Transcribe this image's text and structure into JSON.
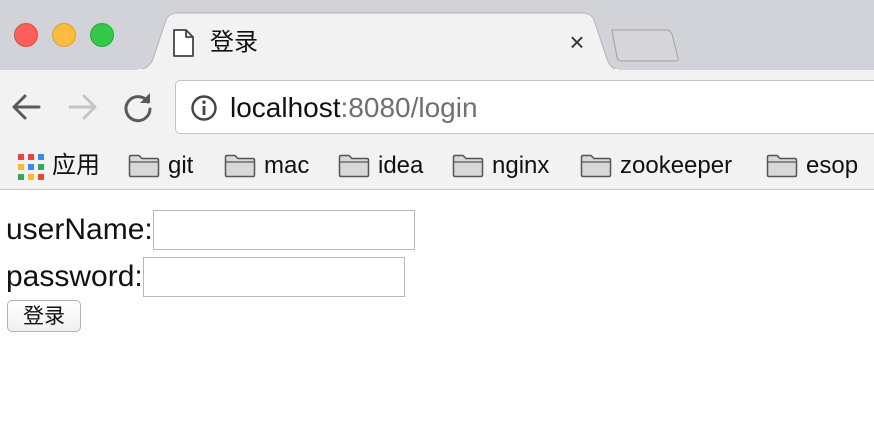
{
  "window": {
    "traffic_lights": [
      "close",
      "minimize",
      "maximize"
    ]
  },
  "tab": {
    "title": "登录",
    "icon": "document-icon",
    "close_glyph": "×"
  },
  "toolbar": {
    "back_icon": "arrow-left-icon",
    "forward_icon": "arrow-right-icon",
    "reload_icon": "reload-icon"
  },
  "address_bar": {
    "info_icon": "info-circle-icon",
    "host": "localhost",
    "rest": ":8080/login"
  },
  "bookmarks": {
    "apps_label": "应用",
    "items": [
      {
        "label": "git"
      },
      {
        "label": "mac"
      },
      {
        "label": "idea"
      },
      {
        "label": "nginx"
      },
      {
        "label": "zookeeper"
      },
      {
        "label": "esop"
      }
    ]
  },
  "form": {
    "username_label": "userName:",
    "username_value": "",
    "password_label": "password:",
    "password_value": "",
    "submit_label": "登录"
  },
  "colors": {
    "tabstrip": "#d2d3d8",
    "toolbar": "#f2f2f2",
    "close_light": "#fc605b",
    "minimize_light": "#fdbc40",
    "maximize_light": "#34c84a",
    "url_rest": "#707070"
  }
}
